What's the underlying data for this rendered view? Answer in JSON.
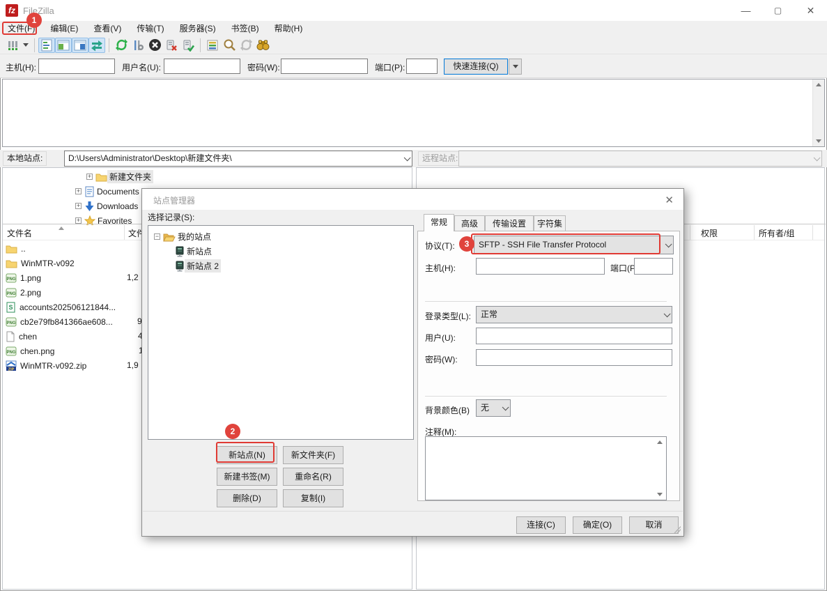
{
  "window": {
    "app_title": "FileZilla"
  },
  "menu_bar": {
    "items": [
      "文件(F)",
      "编辑(E)",
      "查看(V)",
      "传输(T)",
      "服务器(S)",
      "书签(B)",
      "帮助(H)"
    ]
  },
  "toolbar": {
    "icons": [
      "site-manager",
      "site-manager-dropdown",
      "toggle-log-view",
      "toggle-local-tree-view",
      "toggle-remote-tree-view",
      "toggle-transfer-queue",
      "refresh",
      "process-queue",
      "cancel-transfer",
      "disconnect",
      "reconnect",
      "filter",
      "search",
      "synchronized-browsing",
      "directory-comparison"
    ]
  },
  "quickconnect": {
    "host_label": "主机(H):",
    "username_label": "用户名(U):",
    "password_label": "密码(W):",
    "port_label": "端口(P):",
    "connect_button": "快速连接(Q)"
  },
  "site_bars": {
    "local_label": "本地站点:",
    "local_path": "D:\\Users\\Administrator\\Desktop\\新建文件夹\\",
    "remote_label": "远程站点:"
  },
  "local_tree": {
    "items": [
      {
        "label": "新建文件夹",
        "icon": "folder"
      },
      {
        "label": "Documents",
        "icon": "documents"
      },
      {
        "label": "Downloads",
        "icon": "downloads"
      },
      {
        "label": "Favorites",
        "icon": "favorites"
      }
    ]
  },
  "file_list": {
    "name_header": "文件名",
    "size_header": "文件大小",
    "rows": [
      {
        "name": "..",
        "icon": "folder",
        "size": ""
      },
      {
        "name": "WinMTR-v092",
        "icon": "folder",
        "size": ""
      },
      {
        "name": "1.png",
        "icon": "png",
        "size": "1,2"
      },
      {
        "name": "2.png",
        "icon": "png",
        "size": ""
      },
      {
        "name": "accounts202506121844...",
        "icon": "spreadsheet",
        "size": ""
      },
      {
        "name": "cb2e79fb841366ae608...",
        "icon": "png",
        "size": "9"
      },
      {
        "name": "chen",
        "icon": "file",
        "size": "4"
      },
      {
        "name": "chen.png",
        "icon": "png",
        "size": "1"
      },
      {
        "name": "WinMTR-v092.zip",
        "icon": "zip",
        "size": "1,9"
      }
    ]
  },
  "remote_list": {
    "perm_header": "权限",
    "owner_header": "所有者/组"
  },
  "dialog": {
    "title": "站点管理器",
    "select_label": "选择记录(S):",
    "tree_root": "我的站点",
    "tree_children": [
      "新站点",
      "新站点 2"
    ],
    "tabs": [
      "常规",
      "高级",
      "传输设置",
      "字符集"
    ],
    "protocol_label": "协议(T):",
    "protocol_value": "SFTP - SSH File Transfer Protocol",
    "host_label": "主机(H):",
    "port_label": "端口(P):",
    "logon_label": "登录类型(L):",
    "logon_value": "正常",
    "user_label": "用户(U):",
    "password_label": "密码(W):",
    "bgcolor_label": "背景颜色(B)",
    "bgcolor_value": "无",
    "comments_label": "注释(M):",
    "btn_new_site": "新站点(N)",
    "btn_new_folder": "新文件夹(F)",
    "btn_new_bookmark": "新建书签(M)",
    "btn_rename": "重命名(R)",
    "btn_delete": "删除(D)",
    "btn_duplicate": "复制(I)",
    "btn_connect": "连接(C)",
    "btn_ok": "确定(O)",
    "btn_cancel": "取消"
  },
  "annotations": {
    "step1": "1",
    "step2": "2",
    "step3": "3"
  },
  "colors": {
    "annotation_red": "#e03a34",
    "accent_blue": "#0078d7",
    "logo_red": "#bf1d1d",
    "toggle_blue_bg": "#cfe4f7"
  }
}
